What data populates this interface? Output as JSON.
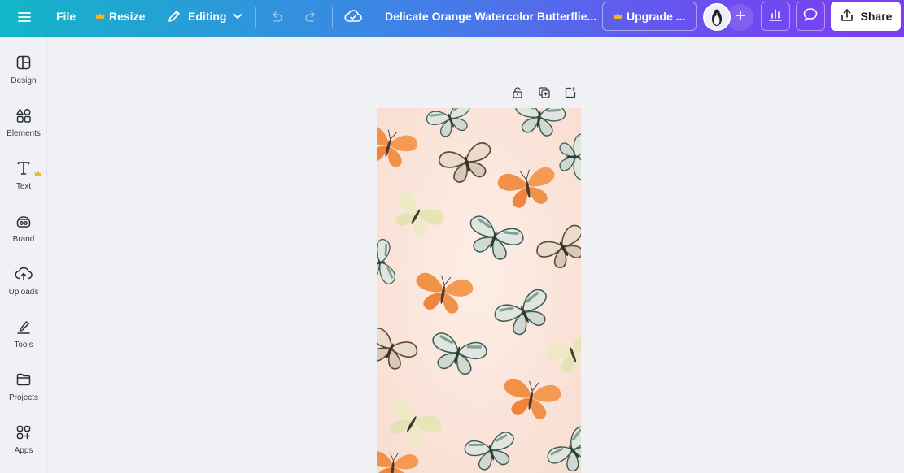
{
  "topbar": {
    "menu_icon": "hamburger-icon",
    "file_label": "File",
    "resize_label": "Resize",
    "editing_label": "Editing",
    "title": "Delicate Orange Watercolor Butterflie...",
    "upgrade_label": "Upgrade ...",
    "share_label": "Share",
    "accent_crown": "#f5b324"
  },
  "sidebar": {
    "items": [
      {
        "label": "Design",
        "icon": "design-icon"
      },
      {
        "label": "Elements",
        "icon": "elements-icon"
      },
      {
        "label": "Text",
        "icon": "text-icon"
      },
      {
        "label": "Brand",
        "icon": "brand-icon"
      },
      {
        "label": "Uploads",
        "icon": "uploads-icon"
      },
      {
        "label": "Tools",
        "icon": "tools-icon"
      },
      {
        "label": "Projects",
        "icon": "folder-icon"
      },
      {
        "label": "Apps",
        "icon": "apps-icon"
      }
    ]
  },
  "canvas": {
    "background": "#fbe6dc",
    "butterfly_colors": [
      "#f08a3c",
      "#5f7d76",
      "#e8e6b8",
      "#6b5a4a"
    ]
  }
}
